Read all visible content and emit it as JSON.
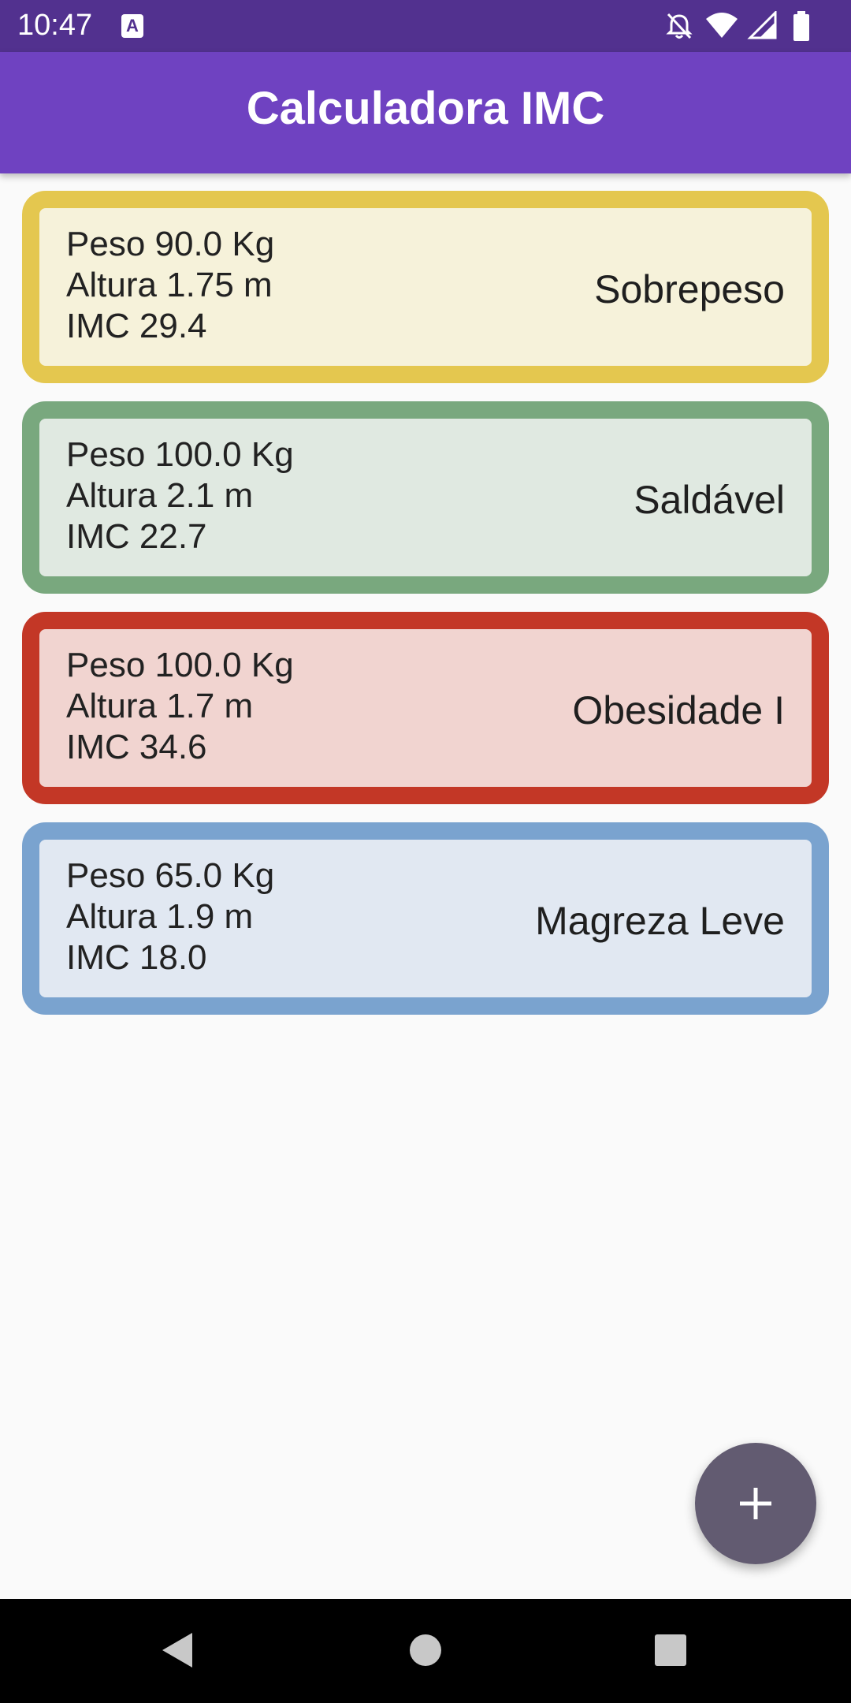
{
  "status_bar": {
    "time": "10:47",
    "notification_icon": "a-icon",
    "icons": [
      "notifications-off-icon",
      "wifi-icon",
      "cellular-signal-icon",
      "battery-icon"
    ]
  },
  "app_bar": {
    "title": "Calculadora IMC",
    "color": "#6f42c1"
  },
  "records": [
    {
      "peso": "Peso 90.0 Kg",
      "altura": "Altura 1.75 m",
      "imc": "IMC 29.4",
      "categoria": "Sobrepeso",
      "border_color": "#e4c74f",
      "bg_color": "#f6f2da"
    },
    {
      "peso": "Peso 100.0 Kg",
      "altura": "Altura 2.1 m",
      "imc": "IMC 22.7",
      "categoria": "Saldável",
      "border_color": "#79a87e",
      "bg_color": "#e0e9e1"
    },
    {
      "peso": "Peso 100.0 Kg",
      "altura": "Altura 1.7 m",
      "imc": "IMC 34.6",
      "categoria": "Obesidade I",
      "border_color": "#c33726",
      "bg_color": "#f1d4d0"
    },
    {
      "peso": "Peso 65.0 Kg",
      "altura": "Altura 1.9 m",
      "imc": "IMC 18.0",
      "categoria": "Magreza Leve",
      "border_color": "#7aa3cf",
      "bg_color": "#e1e8f2"
    }
  ],
  "fab": {
    "icon": "add-icon",
    "color": "#625b71"
  },
  "nav_bar": {
    "icons": [
      "back-icon",
      "home-icon",
      "recents-icon"
    ]
  }
}
